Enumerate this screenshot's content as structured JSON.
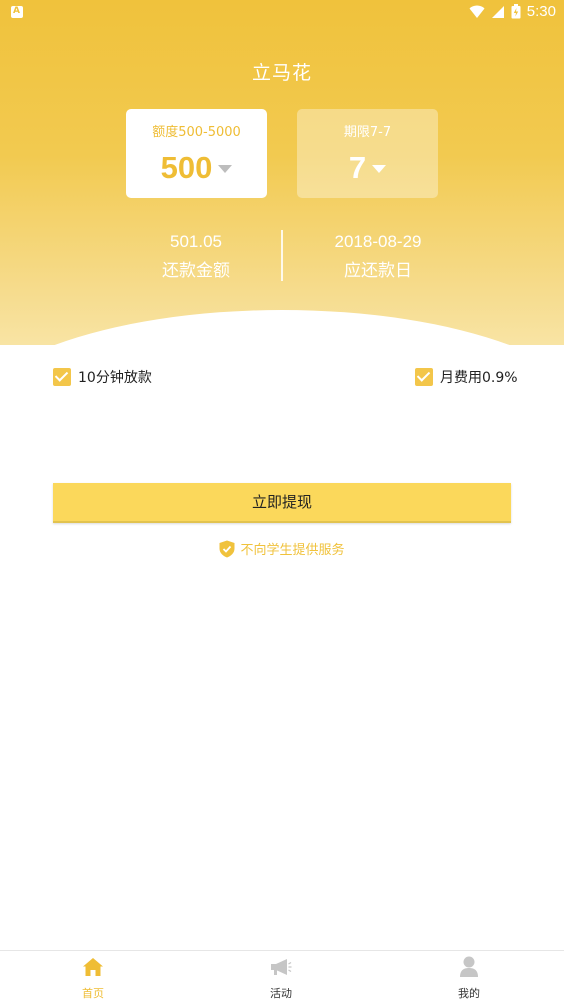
{
  "statusbar": {
    "time": "5:30",
    "app_indicator": "A"
  },
  "app": {
    "title": "立马花"
  },
  "amount_card": {
    "label": "额度500-5000",
    "value": "500"
  },
  "term_card": {
    "label": "期限7-7",
    "value": "7"
  },
  "repay_amount": {
    "value": "501.05",
    "label": "还款金额"
  },
  "repay_date": {
    "value": "2018-08-29",
    "label": "应还款日"
  },
  "features": {
    "left": "10分钟放款",
    "right": "月费用0.9%"
  },
  "withdraw_button": {
    "label": "立即提现"
  },
  "notice": {
    "text": "不向学生提供服务"
  },
  "tabs": [
    {
      "label": "首页",
      "icon": "home-icon",
      "active": true
    },
    {
      "label": "活动",
      "icon": "megaphone-icon",
      "active": false
    },
    {
      "label": "我的",
      "icon": "user-icon",
      "active": false
    }
  ],
  "colors": {
    "accent": "#efbd35",
    "button": "#fbd85b",
    "header_top": "#f0c23c"
  }
}
